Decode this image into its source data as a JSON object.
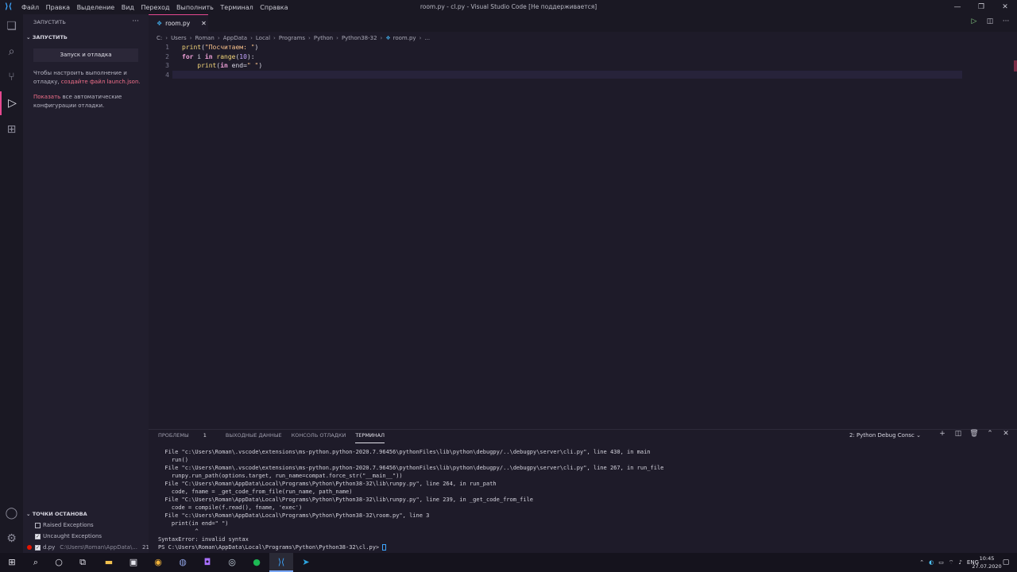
{
  "window": {
    "title": "room.py - cl.py - Visual Studio Code [Не поддерживается]",
    "menu": [
      "Файл",
      "Правка",
      "Выделение",
      "Вид",
      "Переход",
      "Выполнить",
      "Терминал",
      "Справка"
    ],
    "controls": [
      "—",
      "❐",
      "✕"
    ]
  },
  "sidebar": {
    "header": "ЗАПУСТИТЬ",
    "more": "···",
    "section": "ЗАПУСТИТЬ",
    "run_button": "Запуск и отладка",
    "hint_prefix": "Чтобы настроить выполнение и отладку, ",
    "hint_link": "создайте файл launch.json.",
    "show_link": "Показать",
    "show_suffix": " все автоматические конфигурации отладки.",
    "breakpoints_header": "ТОЧКИ ОСТАНОВА",
    "breakpoints": [
      {
        "label": "Raised Exceptions",
        "checked": false
      },
      {
        "label": "Uncaught Exceptions",
        "checked": true
      }
    ],
    "file_breakpoint": {
      "file": "d.py",
      "path": "C:\\Users\\Roman\\AppData\\...",
      "line": "21"
    }
  },
  "tab": {
    "name": "room.py",
    "close": "✕"
  },
  "breadcrumb": [
    "C:",
    "Users",
    "Roman",
    "AppData",
    "Local",
    "Programs",
    "Python",
    "Python38-32",
    "room.py",
    "..."
  ],
  "editor": {
    "line_numbers": [
      "1",
      "2",
      "3",
      "4"
    ]
  },
  "panel": {
    "tabs": [
      "ПРОБЛЕМЫ",
      "ВЫХОДНЫЕ ДАННЫЕ",
      "КОНСОЛЬ ОТЛАДКИ",
      "ТЕРМИНАЛ"
    ],
    "problems_count": "1",
    "terminal_select": "2: Python Debug Consc",
    "terminal_lines": [
      "  File \"c:\\Users\\Roman\\.vscode\\extensions\\ms-python.python-2020.7.96456\\pythonFiles\\lib\\python\\debugpy/..\\debugpy\\server\\cli.py\", line 430, in main",
      "    run()",
      "  File \"c:\\Users\\Roman\\.vscode\\extensions\\ms-python.python-2020.7.96456\\pythonFiles\\lib\\python\\debugpy/..\\debugpy\\server\\cli.py\", line 267, in run_file",
      "    runpy.run_path(options.target, run_name=compat.force_str(\"__main__\"))",
      "  File \"C:\\Users\\Roman\\AppData\\Local\\Programs\\Python\\Python38-32\\lib\\runpy.py\", line 264, in run_path",
      "    code, fname = _get_code_from_file(run_name, path_name)",
      "  File \"C:\\Users\\Roman\\AppData\\Local\\Programs\\Python\\Python38-32\\lib\\runpy.py\", line 239, in _get_code_from_file",
      "    code = compile(f.read(), fname, 'exec')",
      "  File \"c:\\Users\\Roman\\AppData\\Local\\Programs\\Python\\Python38-32\\room.py\", line 3",
      "    print(in end=\" \")",
      "           ^",
      "SyntaxError: invalid syntax"
    ],
    "prompt": "PS C:\\Users\\Roman\\AppData\\Local\\Programs\\Python\\Python38-32\\cl.py> "
  },
  "taskbar": {
    "lang": "ENG",
    "time": "10:45",
    "date": "27.07.2020"
  }
}
